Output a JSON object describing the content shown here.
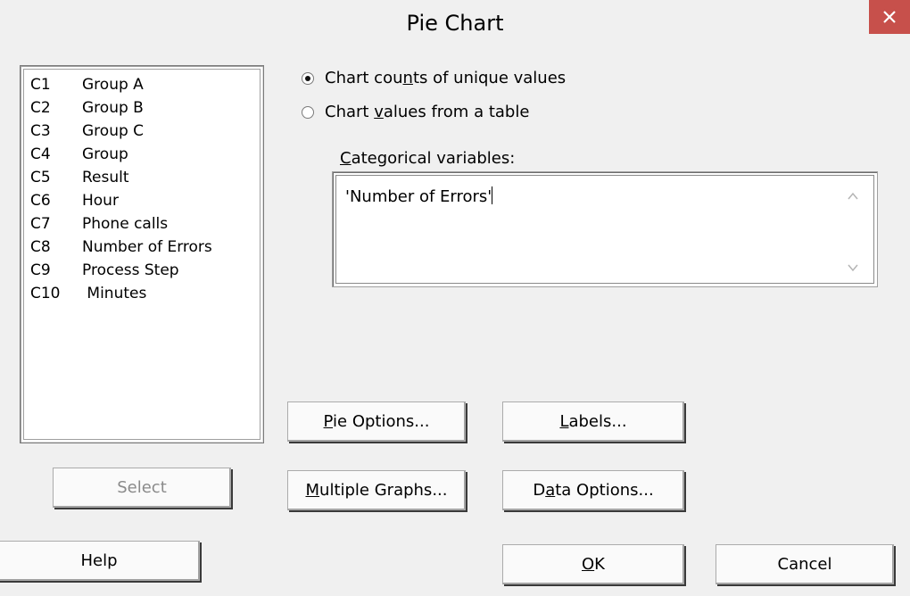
{
  "window": {
    "title": "Pie Chart",
    "close_glyph": "×",
    "close_color": "#c7504b"
  },
  "variables": [
    {
      "col": "C1",
      "name": "Group A"
    },
    {
      "col": "C2",
      "name": "Group B"
    },
    {
      "col": "C3",
      "name": "Group C"
    },
    {
      "col": "C4",
      "name": "Group"
    },
    {
      "col": "C5",
      "name": "Result"
    },
    {
      "col": "C6",
      "name": "Hour"
    },
    {
      "col": "C7",
      "name": "Phone calls"
    },
    {
      "col": "C8",
      "name": "Number of Errors"
    },
    {
      "col": "C9",
      "name": "Process Step"
    },
    {
      "col": "C10",
      "name": " Minutes"
    }
  ],
  "options": {
    "radio_counts": {
      "label": "Chart counts of unique values",
      "selected": true
    },
    "radio_table": {
      "label": "Chart values from a table",
      "selected": false
    }
  },
  "categorical": {
    "label": "Categorical variables:",
    "value": "'Number of Errors'"
  },
  "buttons": {
    "select": "Select",
    "help": "Help",
    "pie_options": "Pie Options...",
    "labels": "Labels...",
    "multiple_graphs": "Multiple Graphs...",
    "data_options": "Data Options...",
    "ok": "OK",
    "cancel": "Cancel"
  },
  "icons": {
    "close": "close-icon",
    "scroll_up": "scroll-up-arrow-icon",
    "scroll_down": "scroll-down-arrow-icon"
  }
}
